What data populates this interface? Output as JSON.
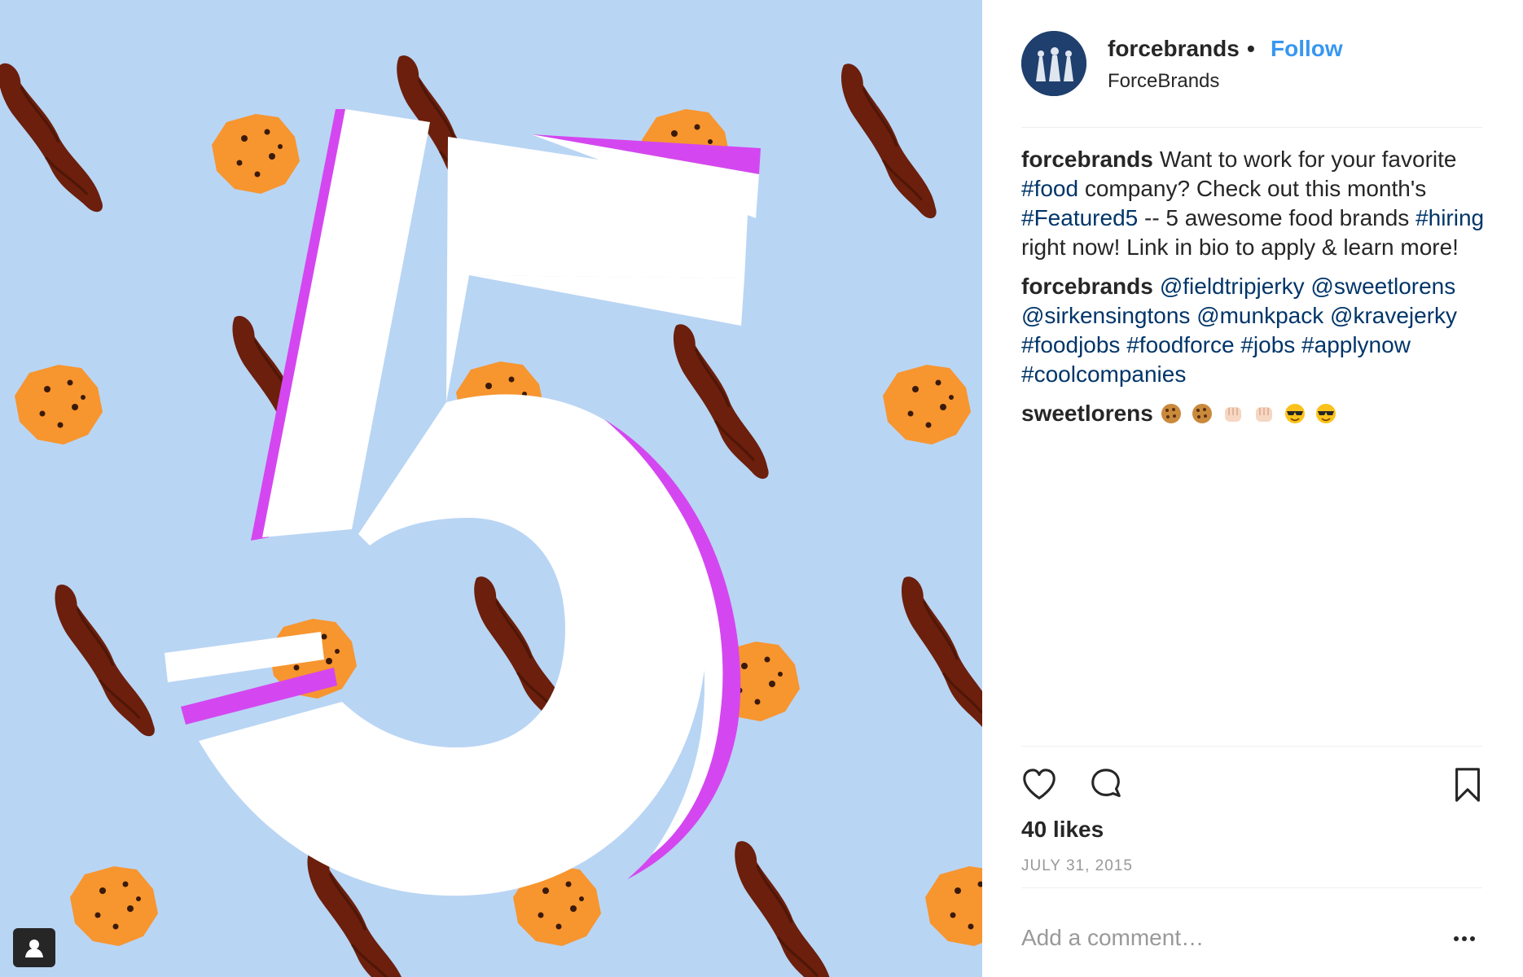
{
  "post": {
    "media": {
      "description_icon": "tag-people-icon",
      "colors": {
        "background": "#b9d5f4",
        "numeral": "#ffffff",
        "accent": "#d447f0",
        "cookie": "#f7952f",
        "jerky": "#6b1f0c"
      }
    },
    "header": {
      "username": "forcebrands",
      "separator": "•",
      "follow_label": "Follow",
      "full_name": "ForceBrands"
    },
    "caption": {
      "author": "forcebrands",
      "segments": [
        {
          "text": "Want to work for your favorite ",
          "type": "text"
        },
        {
          "text": "#food",
          "type": "tag"
        },
        {
          "text": " company? Check out this month's ",
          "type": "text"
        },
        {
          "text": "#Featured5",
          "type": "tag"
        },
        {
          "text": " -- 5 awesome food brands ",
          "type": "text"
        },
        {
          "text": "#hiring",
          "type": "tag"
        },
        {
          "text": " right now! Link in bio to apply & learn more!",
          "type": "text"
        }
      ]
    },
    "comments": [
      {
        "author": "forcebrands",
        "tags": [
          "@fieldtripjerky",
          "@sweetlorens",
          "@sirkensingtons",
          "@munkpack",
          "@kravejerky",
          "#foodjobs",
          "#foodforce",
          "#jobs",
          "#applynow",
          "#coolcompanies"
        ]
      },
      {
        "author": "sweetlorens",
        "emojis": [
          "cookie",
          "cookie",
          "fist",
          "fist",
          "sunglasses-face",
          "sunglasses-face"
        ]
      }
    ],
    "actions": {
      "like_icon": "heart-icon",
      "comment_icon": "comment-bubble-icon",
      "save_icon": "bookmark-icon"
    },
    "likes": "40 likes",
    "date": "JULY 31, 2015",
    "comment_placeholder": "Add a comment…",
    "more_icon": "more-options-icon"
  }
}
